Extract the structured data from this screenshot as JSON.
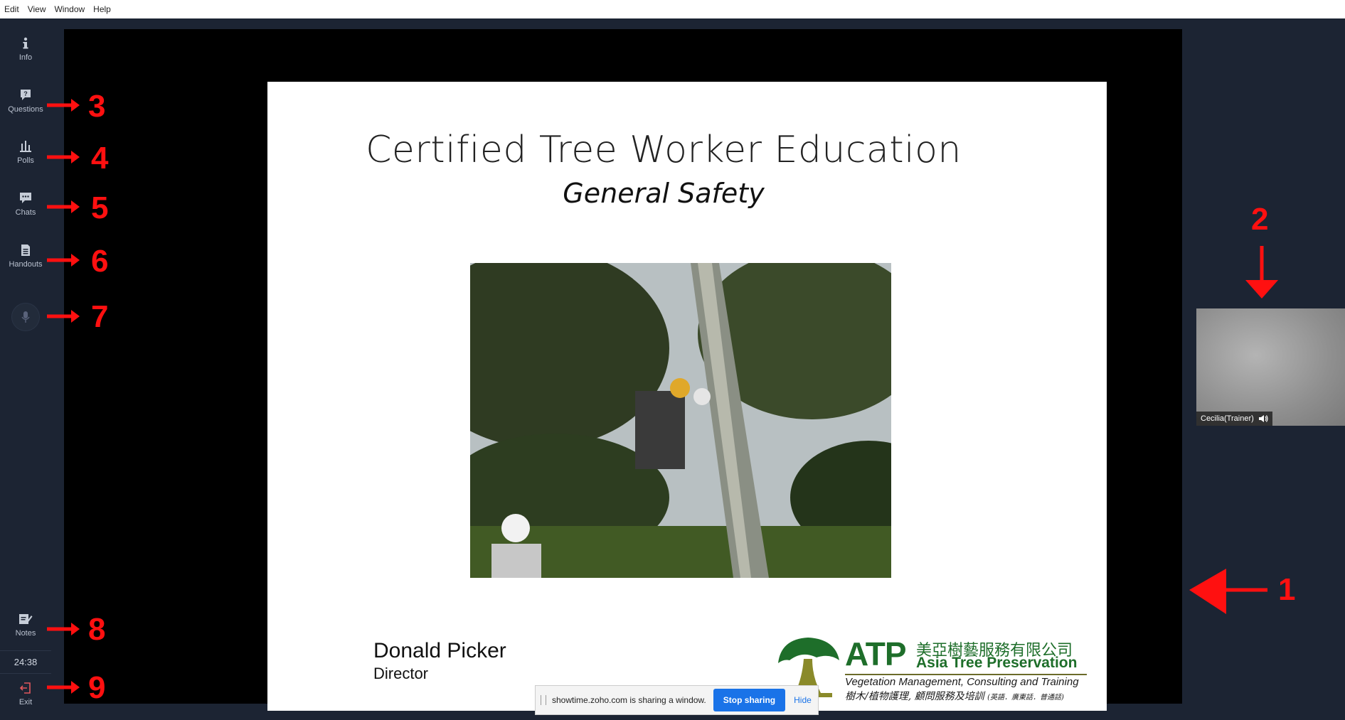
{
  "menubar": {
    "items": [
      "Edit",
      "View",
      "Window",
      "Help"
    ]
  },
  "sidebar": {
    "items": [
      {
        "label": "Info",
        "icon": "info-icon"
      },
      {
        "label": "Questions",
        "icon": "question-icon"
      },
      {
        "label": "Polls",
        "icon": "bar-chart-icon"
      },
      {
        "label": "Chats",
        "icon": "chat-icon"
      },
      {
        "label": "Handouts",
        "icon": "document-icon"
      },
      {
        "label": "",
        "icon": "microphone-icon"
      },
      {
        "label": "Notes",
        "icon": "notes-icon"
      },
      {
        "label": "Exit",
        "icon": "exit-icon"
      }
    ],
    "timer": "24:38"
  },
  "slide": {
    "title": "Certified Tree Worker Education",
    "subtitle": "General Safety",
    "presenter_name": "Donald Picker",
    "presenter_role": "Director",
    "logo": {
      "abbr": "ATP",
      "chinese_name": "美亞樹藝服務有限公司",
      "english_name": "Asia Tree Preservation",
      "tagline": "Vegetation Management, Consulting and Training",
      "chinese_tagline": "樹木/植物護理, 顧問服務及培訓",
      "languages": "(英語．廣東話．普通話)"
    }
  },
  "participant": {
    "name": "Cecilia(Trainer)",
    "icon": "speaker-icon"
  },
  "sharebar": {
    "message": "showtime.zoho.com is sharing a window.",
    "stop_label": "Stop sharing",
    "hide_label": "Hide"
  },
  "annotations": {
    "color": "#ff1010",
    "numbers": [
      "1",
      "2",
      "3",
      "4",
      "5",
      "6",
      "7",
      "8",
      "9"
    ]
  }
}
